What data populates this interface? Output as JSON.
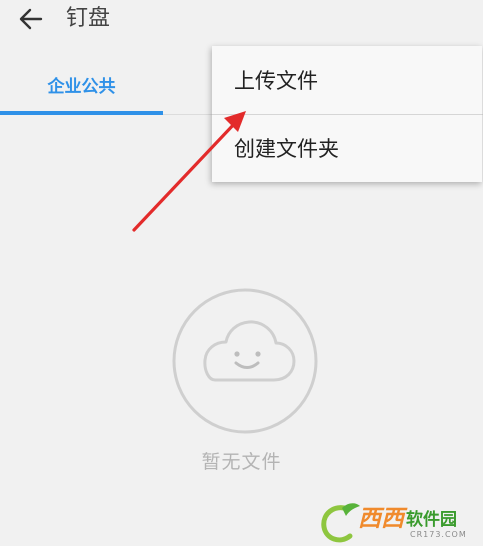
{
  "header": {
    "title": "钉盘",
    "back_icon": "back-arrow-icon"
  },
  "tabs": [
    {
      "label": "企业公共",
      "active": true
    }
  ],
  "accent_color": "#2f91e8",
  "menu": {
    "items": [
      {
        "label": "上传文件"
      },
      {
        "label": "创建文件夹"
      }
    ]
  },
  "empty_state": {
    "icon": "cloud-smile-icon",
    "text": "暂无文件"
  },
  "annotation": {
    "icon": "red-pointer-arrow-icon",
    "color": "#e32b2b"
  },
  "watermark": {
    "brand": "西西",
    "name": "软件园",
    "domain": "CR173.COM"
  }
}
